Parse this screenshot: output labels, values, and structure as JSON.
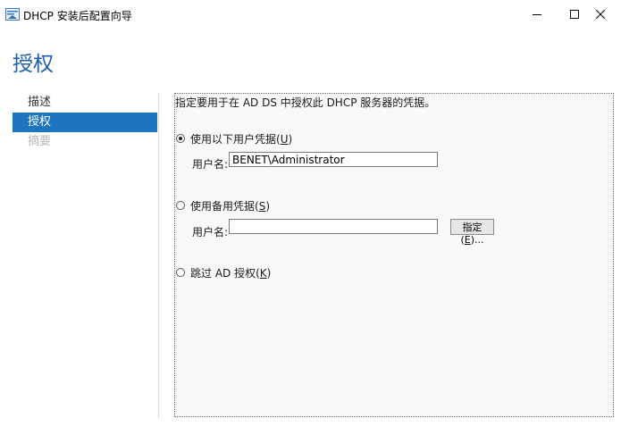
{
  "window": {
    "title": "DHCP 安装后配置向导",
    "icon": "dhcp-app-icon",
    "controls": [
      "minimize-icon",
      "maximize-icon",
      "close-icon"
    ]
  },
  "page": {
    "title": "授权"
  },
  "nav": {
    "items": [
      {
        "label": "描述",
        "state": "normal"
      },
      {
        "label": "授权",
        "state": "selected"
      },
      {
        "label": "摘要",
        "state": "disabled"
      }
    ]
  },
  "content": {
    "instruction": "指定要用于在 AD DS 中授权此 DHCP 服务器的凭据。",
    "option_current": {
      "label": "使用以下用户凭据(",
      "key": "U",
      "suffix": ")",
      "checked": true,
      "username_label": "用户名:",
      "username_value": "BENET\\Administrator"
    },
    "option_alternate": {
      "label": "使用备用凭据(",
      "key": "S",
      "suffix": ")",
      "checked": false,
      "username_label": "用户名:",
      "username_value": "",
      "specify_button_label": "指定(",
      "specify_button_key": "E",
      "specify_button_suffix": ")..."
    },
    "option_skip": {
      "label": "跳过 AD 授权(",
      "key": "K",
      "suffix": ")",
      "checked": false
    }
  },
  "colors": {
    "title": "#1e5fa8",
    "nav_selected_bg": "#1e75bf",
    "nav_disabled": "#b8b8b8"
  }
}
